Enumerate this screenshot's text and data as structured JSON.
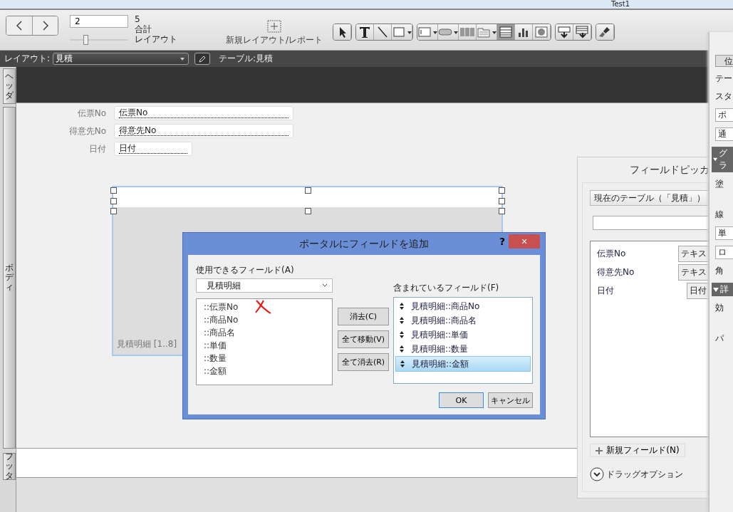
{
  "window": {
    "title": "Test1"
  },
  "toolbar": {
    "record": "2",
    "total": "5",
    "total_label": "合計",
    "mode_label": "レイアウト",
    "slider": {
      "level": 0.27
    },
    "new_layout": "新規レイアウト/レポート",
    "tool_groups": [
      [
        {
          "kind": "pointer",
          "selected": false,
          "dropdown": false
        }
      ],
      [
        {
          "kind": "text",
          "selected": false,
          "dropdown": false
        },
        {
          "kind": "line",
          "selected": false,
          "dropdown": false
        },
        {
          "kind": "rect",
          "selected": false,
          "dropdown": true
        }
      ],
      [
        {
          "kind": "field",
          "selected": false,
          "dropdown": true
        },
        {
          "kind": "button",
          "selected": false,
          "dropdown": true
        },
        {
          "kind": "buttonbar",
          "selected": false,
          "dropdown": false
        },
        {
          "kind": "tabs",
          "selected": false,
          "dropdown": true
        },
        {
          "kind": "portal",
          "selected": true,
          "dropdown": false
        },
        {
          "kind": "chart",
          "selected": false,
          "dropdown": false
        },
        {
          "kind": "web",
          "selected": false,
          "dropdown": false
        }
      ],
      [
        {
          "kind": "insertfield",
          "selected": false,
          "dropdown": false
        },
        {
          "kind": "insertportal",
          "selected": false,
          "dropdown": false
        }
      ],
      [
        {
          "kind": "brush",
          "selected": false,
          "dropdown": false
        }
      ]
    ]
  },
  "layout_bar": {
    "layout_label": "レイアウト:",
    "layout": "見積",
    "table": "テーブル:見積"
  },
  "parts": [
    {
      "label": "ヘッダ"
    },
    {
      "label": "ボディ"
    },
    {
      "label": "フッタ"
    }
  ],
  "fields": [
    {
      "label": "伝票No",
      "value": "伝票No",
      "wide": true
    },
    {
      "label": "得意先No",
      "value": "得意先No",
      "wide": true
    },
    {
      "label": "日付",
      "value": "日付",
      "wide": false
    }
  ],
  "portal": {
    "label": "見積明細 [1..8]"
  },
  "dialog": {
    "title": "ポータルにフィールドを追加",
    "help": "?",
    "close": "×",
    "available_label": "使用できるフィールド(A)",
    "table": "見積明細",
    "available": [
      "::伝票No",
      "::商品No",
      "::商品名",
      "::単価",
      "::数量",
      "::金額"
    ],
    "buttons": [
      "消去(C)",
      "全て移動(V)",
      "全て消去(R)"
    ],
    "included_label": "含まれているフィールド(F)",
    "included": [
      {
        "label": "見積明細::商品No",
        "selected": false
      },
      {
        "label": "見積明細::商品名",
        "selected": false
      },
      {
        "label": "見積明細::単価",
        "selected": false
      },
      {
        "label": "見積明細::数量",
        "selected": false
      },
      {
        "label": "見積明細::金額",
        "selected": true
      }
    ],
    "ok": "OK",
    "cancel": "キャンセル"
  },
  "field_picker": {
    "title": "フィールドピッカ",
    "table": "現在のテーブル（「見積」）",
    "fields": [
      {
        "name": "伝票No",
        "type": "テキス"
      },
      {
        "name": "得意先No",
        "type": "テキス"
      },
      {
        "name": "日付",
        "type": "日付"
      }
    ],
    "new_field": "新規フィールド(N)",
    "drag_options": "ドラッグオプション"
  },
  "inspector": {
    "items": [
      {
        "kind": "tab",
        "text": "位"
      },
      {
        "kind": "label",
        "text": "テー"
      },
      {
        "kind": "label",
        "text": "スタ"
      },
      {
        "kind": "field",
        "text": "ポ"
      },
      {
        "kind": "field",
        "text": "通"
      },
      {
        "kind": "section",
        "text": "グラ"
      },
      {
        "kind": "label",
        "text": "塗"
      },
      {
        "kind": "gap"
      },
      {
        "kind": "label",
        "text": "線"
      },
      {
        "kind": "field",
        "text": "単"
      },
      {
        "kind": "field",
        "text": "ロ"
      },
      {
        "kind": "label",
        "text": "角"
      },
      {
        "kind": "section",
        "text": "詳"
      },
      {
        "kind": "label",
        "text": "効"
      },
      {
        "kind": "gap"
      },
      {
        "kind": "label",
        "text": "パ"
      }
    ]
  }
}
